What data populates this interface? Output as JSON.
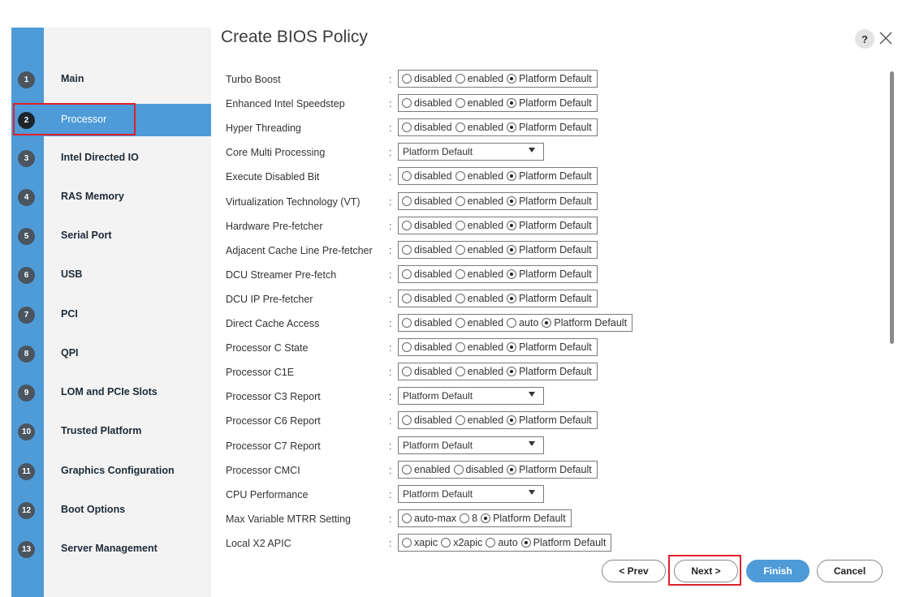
{
  "dialog": {
    "title": "Create BIOS Policy",
    "help_label": "?"
  },
  "sidebar": {
    "items": [
      {
        "num": "1",
        "label": "Main"
      },
      {
        "num": "2",
        "label": "Processor",
        "active": true
      },
      {
        "num": "3",
        "label": "Intel Directed IO"
      },
      {
        "num": "4",
        "label": "RAS Memory"
      },
      {
        "num": "5",
        "label": "Serial Port"
      },
      {
        "num": "6",
        "label": "USB"
      },
      {
        "num": "7",
        "label": "PCI"
      },
      {
        "num": "8",
        "label": "QPI"
      },
      {
        "num": "9",
        "label": "LOM and PCIe Slots"
      },
      {
        "num": "10",
        "label": "Trusted Platform"
      },
      {
        "num": "11",
        "label": "Graphics Configuration"
      },
      {
        "num": "12",
        "label": "Boot Options"
      },
      {
        "num": "13",
        "label": "Server Management"
      }
    ]
  },
  "form": {
    "colon": ":",
    "rows": [
      {
        "label": "Turbo Boost",
        "type": "radio",
        "options": [
          "disabled",
          "enabled",
          "Platform Default"
        ],
        "selected": 2
      },
      {
        "label": "Enhanced Intel Speedstep",
        "type": "radio",
        "options": [
          "disabled",
          "enabled",
          "Platform Default"
        ],
        "selected": 2
      },
      {
        "label": "Hyper Threading",
        "type": "radio",
        "options": [
          "disabled",
          "enabled",
          "Platform Default"
        ],
        "selected": 2
      },
      {
        "label": "Core Multi Processing",
        "type": "select",
        "value": "Platform Default"
      },
      {
        "label": "Execute Disabled Bit",
        "type": "radio",
        "options": [
          "disabled",
          "enabled",
          "Platform Default"
        ],
        "selected": 2
      },
      {
        "label": "Virtualization Technology (VT)",
        "type": "radio",
        "options": [
          "disabled",
          "enabled",
          "Platform Default"
        ],
        "selected": 2
      },
      {
        "label": "Hardware Pre-fetcher",
        "type": "radio",
        "options": [
          "disabled",
          "enabled",
          "Platform Default"
        ],
        "selected": 2
      },
      {
        "label": "Adjacent Cache Line Pre-fetcher",
        "type": "radio",
        "options": [
          "disabled",
          "enabled",
          "Platform Default"
        ],
        "selected": 2
      },
      {
        "label": "DCU Streamer Pre-fetch",
        "type": "radio",
        "options": [
          "disabled",
          "enabled",
          "Platform Default"
        ],
        "selected": 2
      },
      {
        "label": "DCU IP Pre-fetcher",
        "type": "radio",
        "options": [
          "disabled",
          "enabled",
          "Platform Default"
        ],
        "selected": 2
      },
      {
        "label": "Direct Cache Access",
        "type": "radio",
        "options": [
          "disabled",
          "enabled",
          "auto",
          "Platform Default"
        ],
        "selected": 3
      },
      {
        "label": "Processor C State",
        "type": "radio",
        "options": [
          "disabled",
          "enabled",
          "Platform Default"
        ],
        "selected": 2
      },
      {
        "label": "Processor C1E",
        "type": "radio",
        "options": [
          "disabled",
          "enabled",
          "Platform Default"
        ],
        "selected": 2
      },
      {
        "label": "Processor C3 Report",
        "type": "select",
        "value": "Platform Default"
      },
      {
        "label": "Processor C6 Report",
        "type": "radio",
        "options": [
          "disabled",
          "enabled",
          "Platform Default"
        ],
        "selected": 2
      },
      {
        "label": "Processor C7 Report",
        "type": "select",
        "value": "Platform Default"
      },
      {
        "label": "Processor CMCI",
        "type": "radio",
        "options": [
          "enabled",
          "disabled",
          "Platform Default"
        ],
        "selected": 2
      },
      {
        "label": "CPU Performance",
        "type": "select",
        "value": "Platform Default"
      },
      {
        "label": "Max Variable MTRR Setting",
        "type": "radio",
        "options": [
          "auto-max",
          "8",
          "Platform Default"
        ],
        "selected": 2
      },
      {
        "label": "Local X2 APIC",
        "type": "radio",
        "options": [
          "xapic",
          "x2apic",
          "auto",
          "Platform Default"
        ],
        "selected": 3
      }
    ]
  },
  "footer": {
    "prev_label": "< Prev",
    "next_label": "Next >",
    "finish_label": "Finish",
    "cancel_label": "Cancel"
  },
  "colors": {
    "accent": "#4e9bd8",
    "highlight": "#e0202a",
    "step_badge": "#4a5560"
  }
}
